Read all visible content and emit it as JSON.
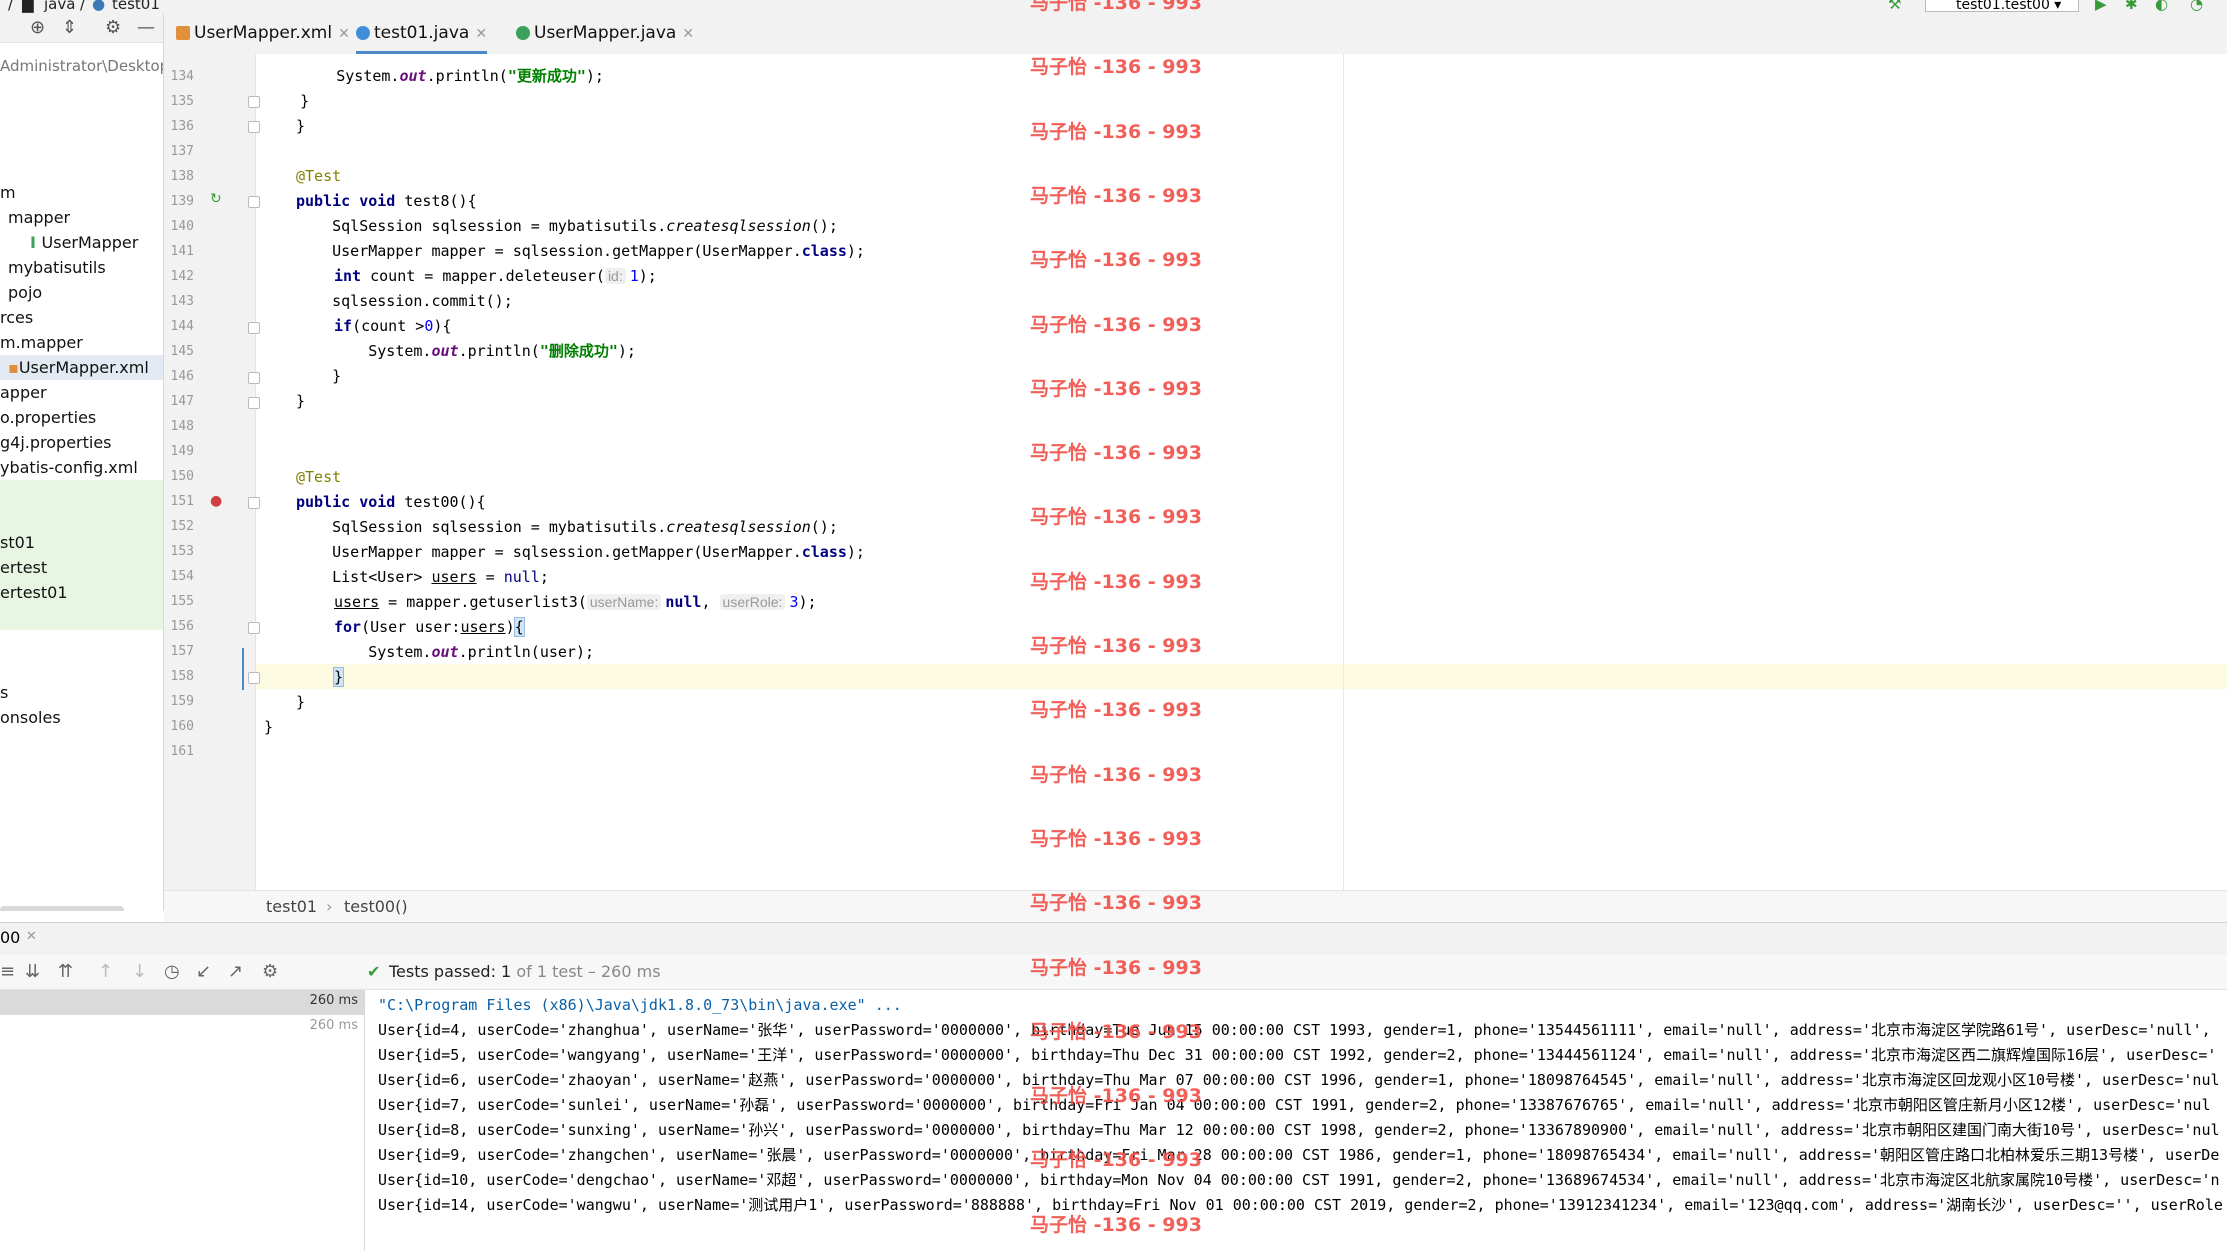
{
  "breadcrumb": {
    "folder": "java",
    "file": "test01"
  },
  "run_config": {
    "label": "test01.test00"
  },
  "tabs": [
    {
      "label": "UserMapper.xml",
      "active": false
    },
    {
      "label": "test01.java",
      "active": true
    },
    {
      "label": "UserMapper.java",
      "active": false
    }
  ],
  "project": {
    "path_fragment": "Administrator\\Desktop",
    "items": [
      {
        "label": "m",
        "indent": 0
      },
      {
        "label": "mapper",
        "indent": 8
      },
      {
        "label": "UserMapper",
        "indent": 30
      },
      {
        "label": "mybatisutils",
        "indent": 8
      },
      {
        "label": "pojo",
        "indent": 8
      },
      {
        "label": "rces",
        "indent": 0
      },
      {
        "label": "m.mapper",
        "indent": 0
      },
      {
        "label": "UserMapper.xml",
        "indent": 8
      },
      {
        "label": "apper",
        "indent": 0
      },
      {
        "label": "o.properties",
        "indent": 0
      },
      {
        "label": "g4j.properties",
        "indent": 0
      },
      {
        "label": "ybatis-config.xml",
        "indent": 0
      },
      {
        "label": "",
        "indent": 0
      },
      {
        "label": "",
        "indent": 0
      },
      {
        "label": "st01",
        "indent": 0
      },
      {
        "label": "ertest",
        "indent": 0
      },
      {
        "label": "ertest01",
        "indent": 0
      },
      {
        "label": "",
        "indent": 0
      },
      {
        "label": "",
        "indent": 0
      },
      {
        "label": "",
        "indent": 0
      },
      {
        "label": "s",
        "indent": 0
      },
      {
        "label": "onsoles",
        "indent": 0
      }
    ]
  },
  "editor": {
    "line_numbers": [
      "134",
      "135",
      "136",
      "137",
      "138",
      "139",
      "140",
      "141",
      "142",
      "143",
      "144",
      "145",
      "146",
      "147",
      "148",
      "149",
      "150",
      "151",
      "152",
      "153",
      "154",
      "155",
      "156",
      "157",
      "158",
      "159",
      "160",
      "161"
    ],
    "code": {
      "l134_pre": "        System.",
      "l134_out": "out",
      "l134_call": ".println(",
      "l134_str": "\"更新成功\"",
      "l134_end": ");",
      "l135": "    }",
      "l136": "}",
      "l138": "@Test",
      "l139_kw": "public void",
      "l139_rest": " test8(){",
      "l140_pre": "    SqlSession sqlsession = mybatisutils.",
      "l140_it": "createsqlsession",
      "l140_end": "();",
      "l141_pre": "    UserMapper mapper = sqlsession.getMapper(UserMapper.",
      "l141_kw": "class",
      "l141_end": ");",
      "l142_kw": "int",
      "l142_pre": " count = mapper.deleteuser(",
      "l142_hint": "id:",
      "l142_num": "1",
      "l142_end": ");",
      "l143": "    sqlsession.commit();",
      "l144_kw": "if",
      "l144_pre": "(count >",
      "l144_num": "0",
      "l144_end": "){",
      "l145_pre": "        System.",
      "l145_out": "out",
      "l145_call": ".println(",
      "l145_str": "\"删除成功\"",
      "l145_end": ");",
      "l146": "    }",
      "l147": "}",
      "l150": "@Test",
      "l151_kw": "public void",
      "l151_rest": " test00(){",
      "l152_pre": "    SqlSession sqlsession = mybatisutils.",
      "l152_it": "createsqlsession",
      "l152_end": "();",
      "l153_pre": "    UserMapper mapper = sqlsession.getMapper(UserMapper.",
      "l153_kw": "class",
      "l153_end": ");",
      "l154_pre": "    List<User> ",
      "l154_var": "users",
      "l154_mid": " = ",
      "l154_kw": "null",
      "l154_end": ";",
      "l155_var": "users",
      "l155_pre": " = mapper.getuserlist3(",
      "l155_hint1": "userName:",
      "l155_kw": "null",
      "l155_comma": ", ",
      "l155_hint2": "userRole:",
      "l155_num": "3",
      "l155_end": ");",
      "l156_kw": "for",
      "l156_pre": "(User user:",
      "l156_var": "users",
      "l156_end": ")",
      "l156_brace": "{",
      "l157_pre": "        System.",
      "l157_out": "out",
      "l157_end": ".println(user);",
      "l158_brace": "}",
      "l159": "}",
      "l160": "}"
    }
  },
  "editor_breadcrumb": {
    "class": "test01",
    "sep": "›",
    "method": "test00()"
  },
  "run": {
    "tab_label": "00",
    "status_prefix": "Tests passed:",
    "status_count": "1",
    "status_suffix": "of 1 test – 260 ms",
    "tree_times": [
      "260 ms",
      "260 ms"
    ],
    "console_lines": [
      "\"C:\\Program Files (x86)\\Java\\jdk1.8.0_73\\bin\\java.exe\" ...",
      "User{id=4, userCode='zhanghua', userName='张华', userPassword='0000000', birthday=Tue Jun 15 00:00:00 CST 1993, gender=1, phone='13544561111', email='null', address='北京市海淀区学院路61号', userDesc='null', ",
      "User{id=5, userCode='wangyang', userName='王洋', userPassword='0000000', birthday=Thu Dec 31 00:00:00 CST 1992, gender=2, phone='13444561124', email='null', address='北京市海淀区西二旗辉煌国际16层', userDesc='",
      "User{id=6, userCode='zhaoyan', userName='赵燕', userPassword='0000000', birthday=Thu Mar 07 00:00:00 CST 1996, gender=1, phone='18098764545', email='null', address='北京市海淀区回龙观小区10号楼', userDesc='nul",
      "User{id=7, userCode='sunlei', userName='孙磊', userPassword='0000000', birthday=Fri Jan 04 00:00:00 CST 1991, gender=2, phone='13387676765', email='null', address='北京市朝阳区管庄新月小区12楼', userDesc='nul",
      "User{id=8, userCode='sunxing', userName='孙兴', userPassword='0000000', birthday=Thu Mar 12 00:00:00 CST 1998, gender=2, phone='13367890900', email='null', address='北京市朝阳区建国门南大街10号', userDesc='nul",
      "User{id=9, userCode='zhangchen', userName='张晨', userPassword='0000000', birthday=Fri Mar 28 00:00:00 CST 1986, gender=1, phone='18098765434', email='null', address='朝阳区管庄路口北柏林爱乐三期13号楼', userDe",
      "User{id=10, userCode='dengchao', userName='邓超', userPassword='0000000', birthday=Mon Nov 04 00:00:00 CST 1991, gender=2, phone='13689674534', email='null', address='北京市海淀区北航家属院10号楼', userDesc='n",
      "User{id=14, userCode='wangwu', userName='测试用户1', userPassword='888888', birthday=Fri Nov 01 00:00:00 CST 2019, gender=2, phone='13912341234', email='123@qq.com', address='湖南长沙', userDesc='', userRole"
    ]
  },
  "watermark": "马子怡 -136 - 993",
  "colors": {
    "accent": "#4a88c7",
    "watermark": "#f0524a",
    "success": "#3a9a3a"
  }
}
